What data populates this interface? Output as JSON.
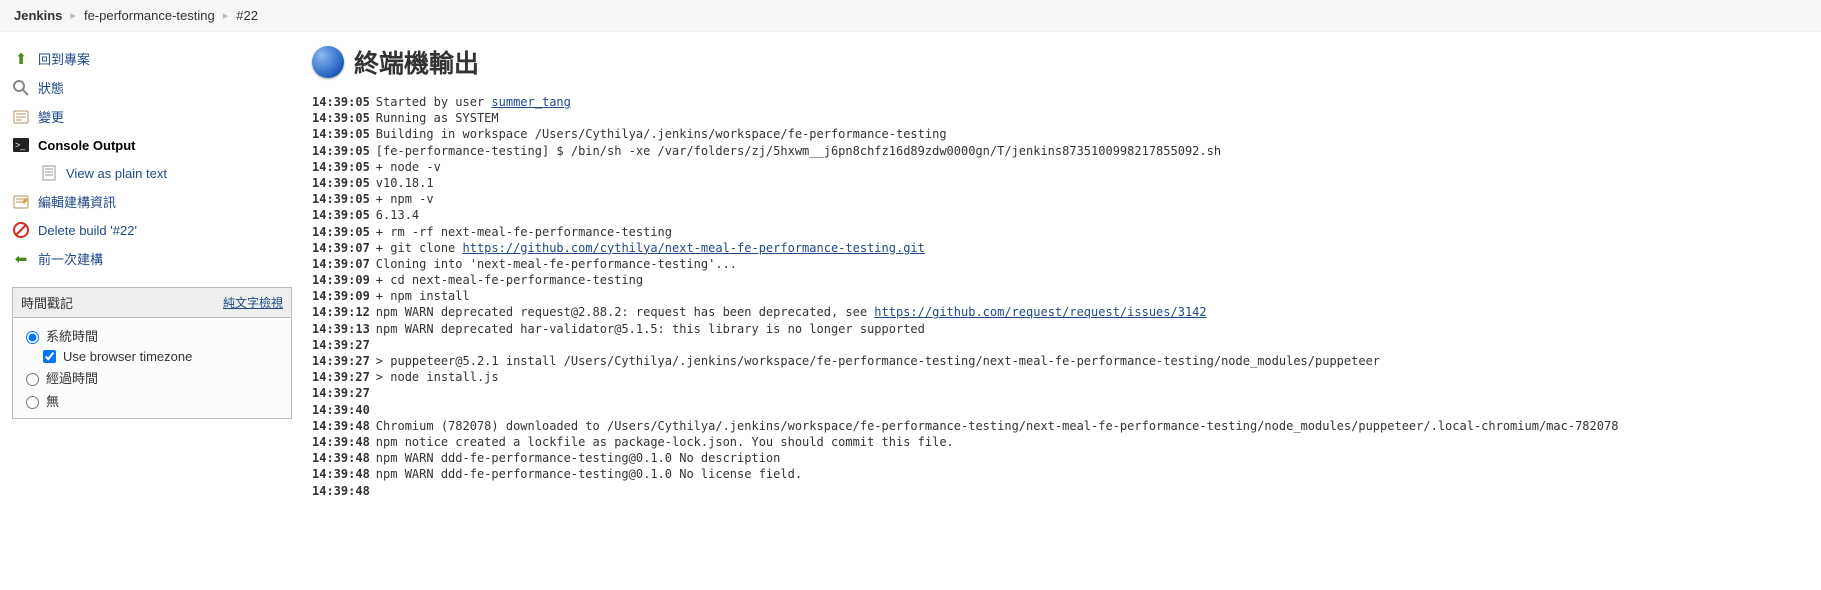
{
  "breadcrumb": {
    "root": "Jenkins",
    "project": "fe-performance-testing",
    "build": "#22"
  },
  "sidebar": {
    "back": "回到專案",
    "status": "狀態",
    "changes": "變更",
    "console": "Console Output",
    "plaintext": "View as plain text",
    "editbuild": "編輯建構資訊",
    "deletebuild": "Delete build '#22'",
    "prevbuild": "前一次建構"
  },
  "timestamps": {
    "title": "時間戳記",
    "viewlink": "純文字檢視",
    "system": "系統時間",
    "usebrowser": "Use browser timezone",
    "elapsed": "經過時間",
    "none": "無"
  },
  "title": "終端機輸出",
  "console": [
    {
      "ts": "14:39:05",
      "parts": [
        "Started by user ",
        {
          "link": "summer_tang",
          "href": "#"
        }
      ]
    },
    {
      "ts": "14:39:05",
      "parts": [
        "Running as SYSTEM"
      ]
    },
    {
      "ts": "14:39:05",
      "parts": [
        "Building in workspace /Users/Cythilya/.jenkins/workspace/fe-performance-testing"
      ]
    },
    {
      "ts": "14:39:05",
      "parts": [
        "[fe-performance-testing] $ /bin/sh -xe /var/folders/zj/5hxwm__j6pn8chfz16d89zdw0000gn/T/jenkins8735100998217855092.sh"
      ]
    },
    {
      "ts": "14:39:05",
      "parts": [
        "+ node -v"
      ]
    },
    {
      "ts": "14:39:05",
      "parts": [
        "v10.18.1"
      ]
    },
    {
      "ts": "14:39:05",
      "parts": [
        "+ npm -v"
      ]
    },
    {
      "ts": "14:39:05",
      "parts": [
        "6.13.4"
      ]
    },
    {
      "ts": "14:39:05",
      "parts": [
        "+ rm -rf next-meal-fe-performance-testing"
      ]
    },
    {
      "ts": "14:39:07",
      "parts": [
        "+ git clone ",
        {
          "link": "https://github.com/cythilya/next-meal-fe-performance-testing.git",
          "href": "#"
        }
      ]
    },
    {
      "ts": "14:39:07",
      "parts": [
        "Cloning into 'next-meal-fe-performance-testing'..."
      ]
    },
    {
      "ts": "14:39:09",
      "parts": [
        "+ cd next-meal-fe-performance-testing"
      ]
    },
    {
      "ts": "14:39:09",
      "parts": [
        "+ npm install"
      ]
    },
    {
      "ts": "14:39:12",
      "parts": [
        "npm WARN deprecated request@2.88.2: request has been deprecated, see ",
        {
          "link": "https://github.com/request/request/issues/3142",
          "href": "#"
        }
      ]
    },
    {
      "ts": "14:39:13",
      "parts": [
        "npm WARN deprecated har-validator@5.1.5: this library is no longer supported"
      ]
    },
    {
      "ts": "14:39:27",
      "parts": [
        ""
      ]
    },
    {
      "ts": "14:39:27",
      "parts": [
        "> puppeteer@5.2.1 install /Users/Cythilya/.jenkins/workspace/fe-performance-testing/next-meal-fe-performance-testing/node_modules/puppeteer"
      ]
    },
    {
      "ts": "14:39:27",
      "parts": [
        "> node install.js"
      ]
    },
    {
      "ts": "14:39:27",
      "parts": [
        ""
      ]
    },
    {
      "ts": "14:39:40",
      "parts": [
        ""
      ]
    },
    {
      "ts": "14:39:48",
      "parts": [
        "Chromium (782078) downloaded to /Users/Cythilya/.jenkins/workspace/fe-performance-testing/next-meal-fe-performance-testing/node_modules/puppeteer/.local-chromium/mac-782078"
      ]
    },
    {
      "ts": "14:39:48",
      "parts": [
        "npm notice created a lockfile as package-lock.json. You should commit this file."
      ]
    },
    {
      "ts": "14:39:48",
      "parts": [
        "npm WARN ddd-fe-performance-testing@0.1.0 No description"
      ]
    },
    {
      "ts": "14:39:48",
      "parts": [
        "npm WARN ddd-fe-performance-testing@0.1.0 No license field."
      ]
    },
    {
      "ts": "14:39:48",
      "parts": [
        ""
      ]
    }
  ]
}
